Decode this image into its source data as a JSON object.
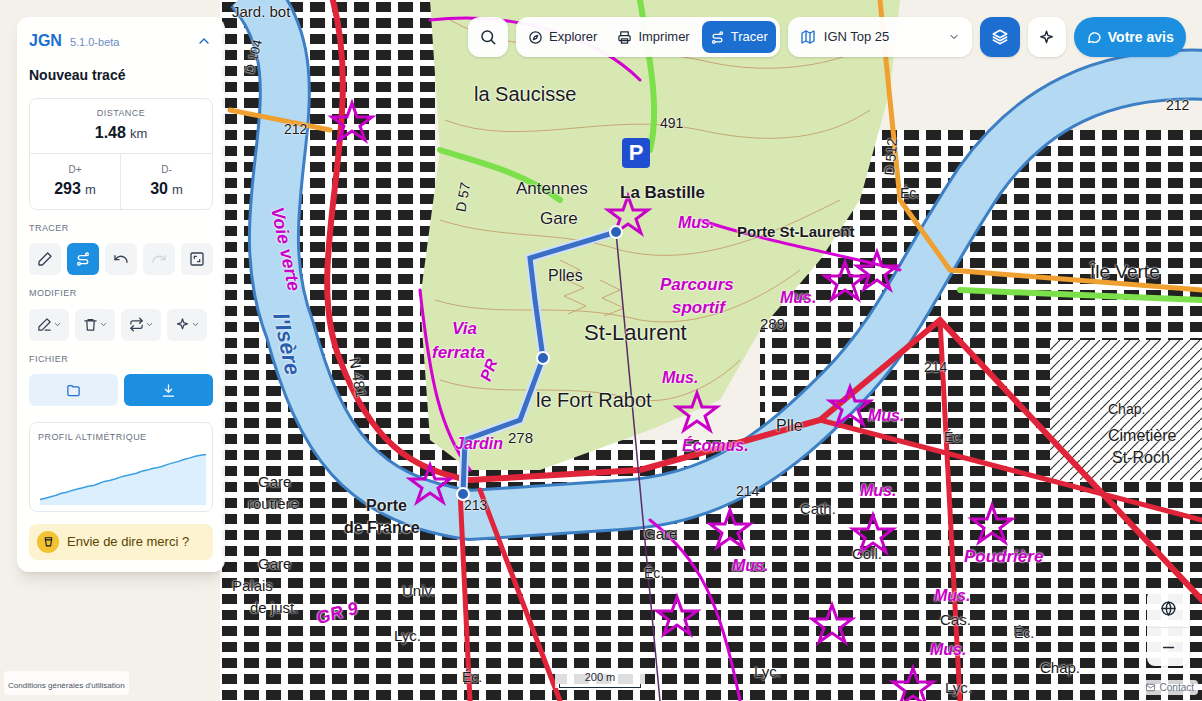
{
  "app": {
    "name": "JGN",
    "version": "5.1.0-beta",
    "trace_title": "Nouveau tracé"
  },
  "stats": {
    "distance_label": "DISTANCE",
    "distance_value": "1.48",
    "distance_unit": "km",
    "dplus_label": "D+",
    "dplus_value": "293",
    "dplus_unit": "m",
    "dminus_label": "D-",
    "dminus_value": "30",
    "dminus_unit": "m"
  },
  "sections": {
    "tracer": "TRACER",
    "modifier": "MODIFIER",
    "fichier": "FICHIER"
  },
  "tracer_tools": [
    {
      "kind": "pencil",
      "selected": false,
      "disabled": false
    },
    {
      "kind": "route",
      "selected": true,
      "disabled": false
    },
    {
      "kind": "undo",
      "selected": false,
      "disabled": false
    },
    {
      "kind": "redo",
      "selected": false,
      "disabled": true
    },
    {
      "kind": "frame",
      "selected": false,
      "disabled": false
    }
  ],
  "modifier_tools": [
    {
      "kind": "edit"
    },
    {
      "kind": "delete"
    },
    {
      "kind": "reverse"
    },
    {
      "kind": "magic"
    }
  ],
  "file_tools": [
    {
      "kind": "open",
      "primary": false
    },
    {
      "kind": "download",
      "primary": true
    }
  ],
  "profile": {
    "title": "PROFIL ALTIMÉTRIQUE",
    "values": [
      213,
      222,
      231,
      240,
      252,
      259,
      270,
      278,
      286,
      296,
      300,
      312,
      325,
      331,
      340,
      352,
      360,
      368,
      375,
      388,
      395,
      404,
      410,
      420,
      432,
      441,
      450,
      462,
      470,
      480,
      486,
      491
    ]
  },
  "thanks": "Envie de dire merci ?",
  "toolbar": {
    "tabs": [
      {
        "label": "Explorer",
        "kind": "compass",
        "selected": false
      },
      {
        "label": "Imprimer",
        "kind": "printer",
        "selected": false
      },
      {
        "label": "Tracer",
        "kind": "route",
        "selected": true
      }
    ],
    "layer": "IGN Top 25",
    "feedback": "Votre avis"
  },
  "map": {
    "parking": "P",
    "scale": "200 m",
    "attribution": "Conditions générales d'utilisation",
    "contact": "Contact",
    "labels": [
      {
        "text": "Jard. bot",
        "color": "#1a1a1a"
      },
      {
        "text": "D 104",
        "color": "#1a1a1a"
      },
      {
        "text": "212",
        "color": "#1a1a1a"
      },
      {
        "text": "la Saucisse",
        "color": "#1a1a1a"
      },
      {
        "text": "D 57",
        "color": "#1a1a1a"
      },
      {
        "text": "491",
        "color": "#1a1a1a"
      },
      {
        "text": "Antennes",
        "color": "#1a1a1a"
      },
      {
        "text": "La Bastille",
        "color": "#1a1a1a"
      },
      {
        "text": "Gare",
        "color": "#1a1a1a"
      },
      {
        "text": "Mus.",
        "color": "#c800c8"
      },
      {
        "text": "Porte St-Laurent",
        "color": "#1a1a1a"
      },
      {
        "text": "D 512",
        "color": "#1a1a1a"
      },
      {
        "text": "212",
        "color": "#1a1a1a"
      },
      {
        "text": "Éc.",
        "color": "#1a1a1a"
      },
      {
        "text": "Plles",
        "color": "#1a1a1a"
      },
      {
        "text": "Parcours",
        "color": "#c800c8"
      },
      {
        "text": "sportif",
        "color": "#c800c8"
      },
      {
        "text": "Mus.",
        "color": "#c800c8"
      },
      {
        "text": "289",
        "color": "#1a1a1a"
      },
      {
        "text": "St-Laurent",
        "color": "#1a1a1a"
      },
      {
        "text": "Via",
        "color": "#c800c8"
      },
      {
        "text": "ferrata",
        "color": "#c800c8"
      },
      {
        "text": "PR",
        "color": "#c800c8"
      },
      {
        "text": "le Fort Rabot",
        "color": "#1a1a1a"
      },
      {
        "text": "Mus.",
        "color": "#c800c8"
      },
      {
        "text": "Jardin",
        "color": "#c800c8"
      },
      {
        "text": "278",
        "color": "#1a1a1a"
      },
      {
        "text": "Écomus.",
        "color": "#c800c8"
      },
      {
        "text": "Plle",
        "color": "#1a1a1a"
      },
      {
        "text": "Mus.",
        "color": "#c800c8"
      },
      {
        "text": "214",
        "color": "#1a1a1a"
      },
      {
        "text": "Éc.",
        "color": "#1a1a1a"
      },
      {
        "text": "Île Verte",
        "color": "#1a1a1a"
      },
      {
        "text": "Chap.",
        "color": "#1a1a1a"
      },
      {
        "text": "Cimetière",
        "color": "#1a1a1a"
      },
      {
        "text": "St-Roch",
        "color": "#1a1a1a"
      },
      {
        "text": "Voie verte",
        "color": "#c800c8"
      },
      {
        "text": "l'Isère",
        "color": "#2a5fb0"
      },
      {
        "text": "N 481",
        "color": "#1a1a1a"
      },
      {
        "text": "Gare",
        "color": "#1a1a1a"
      },
      {
        "text": "routière",
        "color": "#1a1a1a"
      },
      {
        "text": "Porte",
        "color": "#1a1a1a"
      },
      {
        "text": "de France",
        "color": "#1a1a1a"
      },
      {
        "text": "213",
        "color": "#1a1a1a"
      },
      {
        "text": "214",
        "color": "#1a1a1a"
      },
      {
        "text": "Cath.",
        "color": "#1a1a1a"
      },
      {
        "text": "Mus.",
        "color": "#c800c8"
      },
      {
        "text": "Gare",
        "color": "#1a1a1a"
      },
      {
        "text": "Coll.",
        "color": "#1a1a1a"
      },
      {
        "text": "Poudrière",
        "color": "#c800c8"
      },
      {
        "text": "Mus.",
        "color": "#c800c8"
      },
      {
        "text": "Éc.",
        "color": "#1a1a1a"
      },
      {
        "text": "Gare",
        "color": "#1a1a1a"
      },
      {
        "text": "Palais",
        "color": "#1a1a1a"
      },
      {
        "text": "de just.",
        "color": "#1a1a1a"
      },
      {
        "text": "Univ.",
        "color": "#1a1a1a"
      },
      {
        "text": "GR 9",
        "color": "#c800c8"
      },
      {
        "text": "Lyc.",
        "color": "#1a1a1a"
      },
      {
        "text": "Mus.",
        "color": "#c800c8"
      },
      {
        "text": "Cas.",
        "color": "#1a1a1a"
      },
      {
        "text": "Éc.",
        "color": "#1a1a1a"
      },
      {
        "text": "Mus.",
        "color": "#c800c8"
      },
      {
        "text": "Chap.",
        "color": "#1a1a1a"
      },
      {
        "text": "Lyc.",
        "color": "#1a1a1a"
      },
      {
        "text": "Lyc.",
        "color": "#1a1a1a"
      },
      {
        "text": "Éc.",
        "color": "#1a1a1a"
      }
    ]
  }
}
